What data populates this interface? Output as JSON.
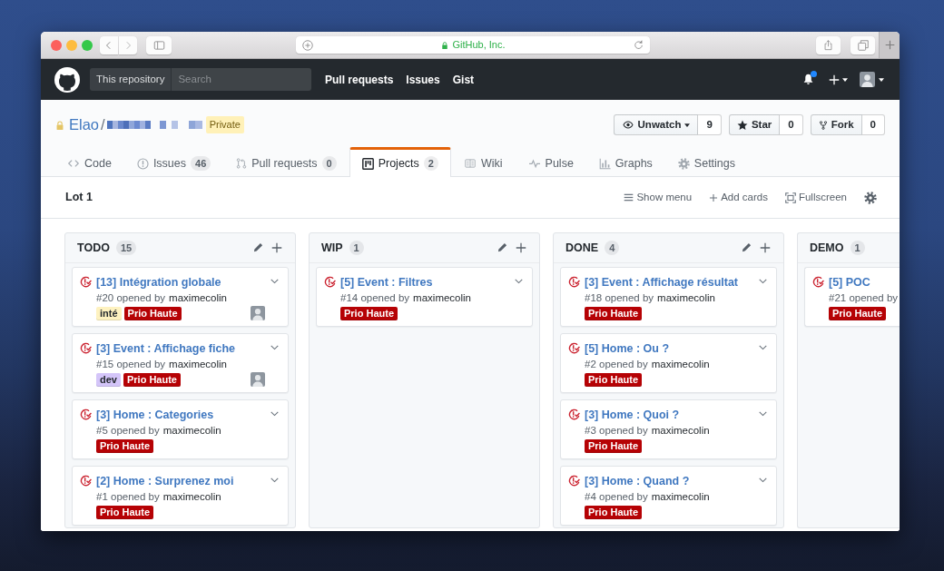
{
  "browser": {
    "address": "GitHub, Inc.",
    "secure": true
  },
  "header": {
    "search_scope": "This repository",
    "search": {
      "placeholder": "Search"
    },
    "nav": [
      "Pull requests",
      "Issues",
      "Gist"
    ],
    "notifications_unread": true
  },
  "repo": {
    "owner": "Elao",
    "separator": "/",
    "visibility": "Private",
    "actions": [
      {
        "kind": "watch",
        "label": "Unwatch",
        "count": "9"
      },
      {
        "kind": "star",
        "label": "Star",
        "count": "0"
      },
      {
        "kind": "fork",
        "label": "Fork",
        "count": "0"
      }
    ]
  },
  "tabs": [
    {
      "kind": "code",
      "label": "Code",
      "selected": false
    },
    {
      "kind": "issues",
      "label": "Issues",
      "counter": "46",
      "selected": false
    },
    {
      "kind": "pulls",
      "label": "Pull requests",
      "counter": "0",
      "selected": false
    },
    {
      "kind": "projects",
      "label": "Projects",
      "counter": "2",
      "selected": true
    },
    {
      "kind": "wiki",
      "label": "Wiki",
      "selected": false
    },
    {
      "kind": "pulse",
      "label": "Pulse",
      "selected": false
    },
    {
      "kind": "graphs",
      "label": "Graphs",
      "selected": false
    },
    {
      "kind": "settings",
      "label": "Settings",
      "selected": false
    }
  ],
  "project": {
    "name": "Lot 1",
    "actions": [
      {
        "kind": "menu",
        "label": "Show menu"
      },
      {
        "kind": "add",
        "label": "Add cards"
      },
      {
        "kind": "fullscreen",
        "label": "Fullscreen"
      }
    ]
  },
  "columns": [
    {
      "name": "TODO",
      "count": "15",
      "cut_off": false,
      "cards": [
        {
          "title": "[13] Intégration globale",
          "meta": "#20 opened by",
          "author": "maximecolin",
          "labels": [
            {
              "name": "inté",
              "color": "#fef2c0"
            },
            {
              "name": "Prio Haute",
              "color": "#b60205"
            }
          ],
          "assigned": true
        },
        {
          "title": "[3] Event : Affichage fiche",
          "meta": "#15 opened by",
          "author": "maximecolin",
          "labels": [
            {
              "name": "dev",
              "color": "#d4c5f9"
            },
            {
              "name": "Prio Haute",
              "color": "#b60205"
            }
          ],
          "assigned": true
        },
        {
          "title": "[3] Home : Categories",
          "meta": "#5 opened by",
          "author": "maximecolin",
          "labels": [
            {
              "name": "Prio Haute",
              "color": "#b60205"
            }
          ],
          "assigned": false
        },
        {
          "title": "[2] Home : Surprenez moi",
          "meta": "#1 opened by",
          "author": "maximecolin",
          "labels": [
            {
              "name": "Prio Haute",
              "color": "#b60205"
            }
          ],
          "assigned": false
        }
      ]
    },
    {
      "name": "WIP",
      "count": "1",
      "cut_off": false,
      "cards": [
        {
          "title": "[5] Event : Filtres",
          "meta": "#14 opened by",
          "author": "maximecolin",
          "labels": [
            {
              "name": "Prio Haute",
              "color": "#b60205"
            }
          ],
          "assigned": false
        }
      ]
    },
    {
      "name": "DONE",
      "count": "4",
      "cut_off": false,
      "cards": [
        {
          "title": "[3] Event : Affichage résultat",
          "meta": "#18 opened by",
          "author": "maximecolin",
          "labels": [
            {
              "name": "Prio Haute",
              "color": "#b60205"
            }
          ],
          "assigned": false
        },
        {
          "title": "[5] Home : Ou ?",
          "meta": "#2 opened by",
          "author": "maximecolin",
          "labels": [
            {
              "name": "Prio Haute",
              "color": "#b60205"
            }
          ],
          "assigned": false
        },
        {
          "title": "[3] Home : Quoi ?",
          "meta": "#3 opened by",
          "author": "maximecolin",
          "labels": [
            {
              "name": "Prio Haute",
              "color": "#b60205"
            }
          ],
          "assigned": false
        },
        {
          "title": "[3] Home : Quand ?",
          "meta": "#4 opened by",
          "author": "maximecolin",
          "labels": [
            {
              "name": "Prio Haute",
              "color": "#b60205"
            }
          ],
          "assigned": false
        }
      ]
    },
    {
      "name": "DEMO",
      "count": "1",
      "cut_off": true,
      "cards": [
        {
          "title": "[5] POC",
          "meta": "#21 opened by",
          "labels": [
            {
              "name": "Prio Haute",
              "color": "#b60205"
            }
          ],
          "assigned": false
        }
      ]
    }
  ]
}
